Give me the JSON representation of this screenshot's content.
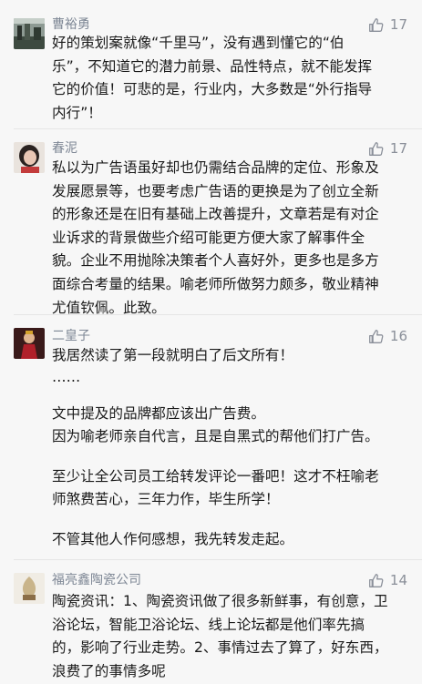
{
  "comments": [
    {
      "author": "曹裕勇",
      "likes": "17",
      "lines": [
        "好的策划案就像“千里马”，没有遇到懂它的“伯",
        "乐”，不知道它的潜力前景、品性特点，就不能发挥",
        "它的价值！可悲的是，行业内，大多数是“外行指导",
        "内行”！"
      ]
    },
    {
      "author": "春泥",
      "likes": "17",
      "lines": [
        "私以为广告语虽好却也仍需结合品牌的定位、形象及",
        "发展愿景等，也要考虑广告语的更换是为了创立全新",
        "的形象还是在旧有基础上改善提升，文章若是有对企",
        "业诉求的背景做些介绍可能更方便大家了解事件全",
        "貌。企业不用抛除决策者个人喜好外，更多也是多方",
        "面综合考量的结果。喻老师所做努力颇多，敬业精神",
        "尤值钦佩。此致。"
      ]
    },
    {
      "author": "二皇子",
      "likes": "16",
      "lines": [
        "我居然读了第一段就明白了后文所有！",
        "……",
        "",
        "文中提及的品牌都应该出广告费。",
        "因为喻老师亲自代言，且是自黑式的帮他们打广告。",
        "",
        "至少让全公司员工给转发评论一番吧！这才不枉喻老",
        "师煞费苦心，三年力作，毕生所学！",
        "",
        "不管其他人作何感想，我先转发走起。"
      ]
    },
    {
      "author": "福亮鑫陶瓷公司",
      "likes": "14",
      "lines": [
        "陶瓷资讯：1、陶瓷资讯做了很多新鲜事，有创意，卫",
        "浴论坛，智能卫浴论坛、线上论坛都是他们率先搞",
        "的，影响了行业走势。2、事情过去了算了，好东西，",
        "浪费了的事情多呢"
      ]
    }
  ]
}
